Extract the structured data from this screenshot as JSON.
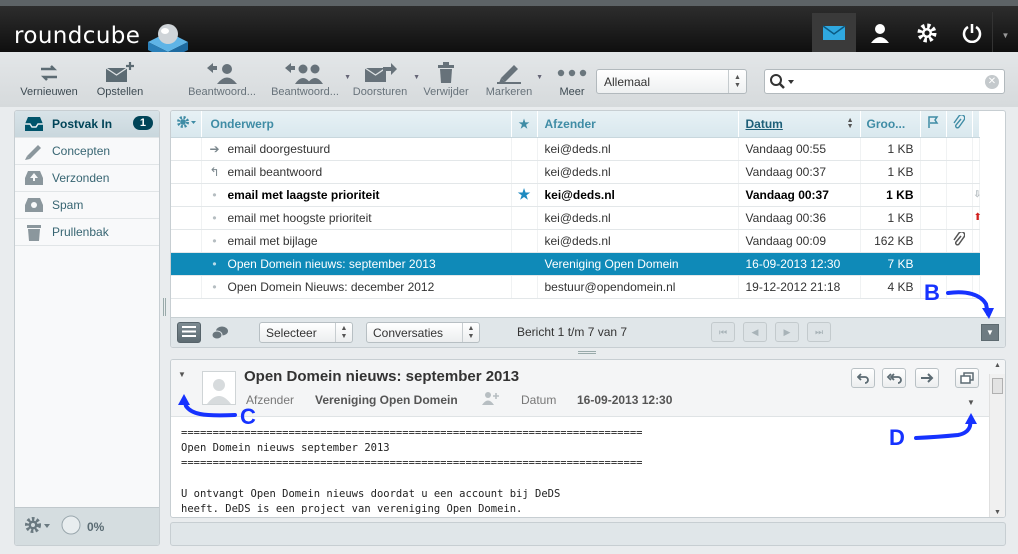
{
  "app": {
    "name": "roundcube"
  },
  "topnav": [
    {
      "name": "mail-icon"
    },
    {
      "name": "contacts-icon"
    },
    {
      "name": "settings-icon"
    },
    {
      "name": "logout-icon"
    }
  ],
  "toolbar": {
    "refresh": "Vernieuwen",
    "compose": "Opstellen",
    "reply": "Beantwoord...",
    "reply_all": "Beantwoord...",
    "forward": "Doorsturen",
    "delete": "Verwijder",
    "mark": "Markeren",
    "more": "Meer"
  },
  "filter": {
    "value": "Allemaal"
  },
  "search": {
    "placeholder": ""
  },
  "folders": [
    {
      "label": "Postvak In",
      "badge": "1",
      "icon": "inbox-icon"
    },
    {
      "label": "Concepten",
      "icon": "pencil-icon"
    },
    {
      "label": "Verzonden",
      "icon": "sent-icon"
    },
    {
      "label": "Spam",
      "icon": "spam-icon"
    },
    {
      "label": "Prullenbak",
      "icon": "trash-icon"
    }
  ],
  "quota": "0%",
  "list": {
    "columns": {
      "subject": "Onderwerp",
      "from": "Afzender",
      "date": "Datum",
      "size": "Groo..."
    },
    "rows": [
      {
        "status": "forwarded",
        "subject": "email doorgestuurd",
        "from": "kei@deds.nl",
        "date": "Vandaag 00:55",
        "size": "1 KB"
      },
      {
        "status": "replied",
        "subject": "email beantwoord",
        "from": "kei@deds.nl",
        "date": "Vandaag 00:37",
        "size": "1 KB"
      },
      {
        "status": "unread",
        "subject": "email met laagste prioriteit",
        "from": "kei@deds.nl",
        "date": "Vandaag 00:37",
        "size": "1 KB",
        "flagged": true,
        "priority": "low"
      },
      {
        "status": "read",
        "subject": "email met hoogste prioriteit",
        "from": "kei@deds.nl",
        "date": "Vandaag 00:36",
        "size": "1 KB",
        "priority": "high"
      },
      {
        "status": "read",
        "subject": "email met bijlage",
        "from": "kei@deds.nl",
        "date": "Vandaag 00:09",
        "size": "162 KB",
        "attachment": true
      },
      {
        "status": "read",
        "subject": "Open Domein nieuws: september 2013",
        "from": "Vereniging Open Domein",
        "date": "16-09-2013 12:30",
        "size": "7 KB",
        "selected": true
      },
      {
        "status": "read",
        "subject": "Open Domein Nieuws: december 2012",
        "from": "bestuur@opendomein.nl",
        "date": "19-12-2012 21:18",
        "size": "4 KB"
      }
    ],
    "footer": {
      "select": "Selecteer",
      "threads": "Conversaties",
      "count": "Bericht 1 t/m 7 van 7"
    }
  },
  "preview": {
    "subject": "Open Domein nieuws: september 2013",
    "from_label": "Afzender",
    "from": "Vereniging Open Domein",
    "date_label": "Datum",
    "date": "16-09-2013 12:30",
    "body": "=========================================================================\nOpen Domein nieuws september 2013\n=========================================================================\n\nU ontvangt Open Domein nieuws doordat u een account bij DeDS\nheeft. DeDS is een project van vereniging Open Domein."
  },
  "annotations": {
    "b": "B",
    "c": "C",
    "d": "D"
  },
  "colors": {
    "accent": "#0f8ab8",
    "topbar": "#1a1a1a",
    "annotation": "#1632ff"
  }
}
